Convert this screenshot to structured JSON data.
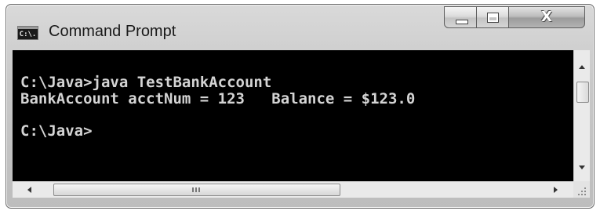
{
  "window": {
    "title": "Command Prompt",
    "icon_text": "C:\\."
  },
  "console": {
    "lines": [
      "C:\\Java>java TestBankAccount",
      "BankAccount acctNum = 123   Balance = $123.0",
      "C:\\Java>"
    ]
  },
  "caption_buttons": {
    "minimize": "minimize-icon",
    "maximize": "maximize-icon",
    "close": "close-icon",
    "close_glyph": "X"
  },
  "icons": {
    "scroll_up": "scroll-up-arrow-icon",
    "scroll_down": "scroll-down-arrow-icon",
    "scroll_left": "scroll-left-arrow-icon",
    "scroll_right": "scroll-right-arrow-icon",
    "grip": "resize-grip-icon"
  },
  "colors": {
    "console_background": "#000000",
    "console_text": "#d4d4d4"
  }
}
